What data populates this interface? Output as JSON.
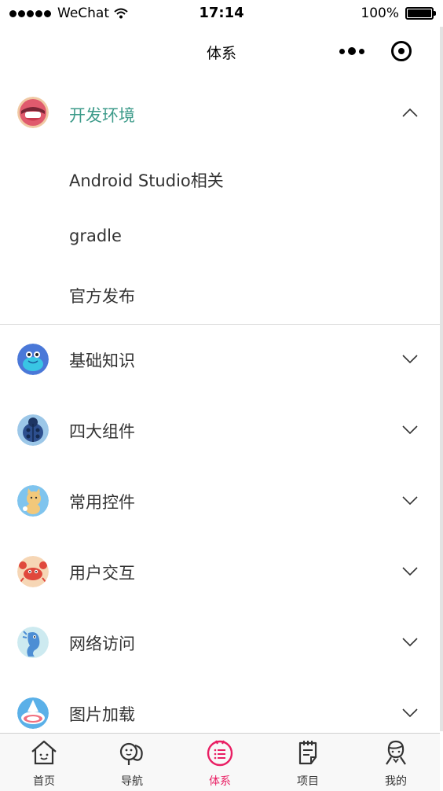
{
  "status_bar": {
    "carrier": "WeChat",
    "time": "17:14",
    "battery": "100%"
  },
  "nav": {
    "title": "体系"
  },
  "accent_color": "#3d9b8a",
  "categories": [
    {
      "label": "开发环境",
      "expanded": true,
      "icon": "robot-avatar-icon",
      "children": [
        "Android Studio相关",
        "gradle",
        "官方发布"
      ]
    },
    {
      "label": "基础知识",
      "expanded": false,
      "icon": "monster-avatar-icon"
    },
    {
      "label": "四大组件",
      "expanded": false,
      "icon": "ladybug-avatar-icon"
    },
    {
      "label": "常用控件",
      "expanded": false,
      "icon": "cat-avatar-icon"
    },
    {
      "label": "用户交互",
      "expanded": false,
      "icon": "crab-avatar-icon"
    },
    {
      "label": "网络访问",
      "expanded": false,
      "icon": "seahorse-avatar-icon"
    },
    {
      "label": "图片加载",
      "expanded": false,
      "icon": "shark-avatar-icon"
    }
  ],
  "tabs": [
    {
      "label": "首页",
      "icon": "home-icon",
      "active": false
    },
    {
      "label": "导航",
      "icon": "navigation-icon",
      "active": false
    },
    {
      "label": "体系",
      "icon": "system-list-icon",
      "active": true
    },
    {
      "label": "项目",
      "icon": "project-icon",
      "active": false
    },
    {
      "label": "我的",
      "icon": "profile-icon",
      "active": false
    }
  ]
}
